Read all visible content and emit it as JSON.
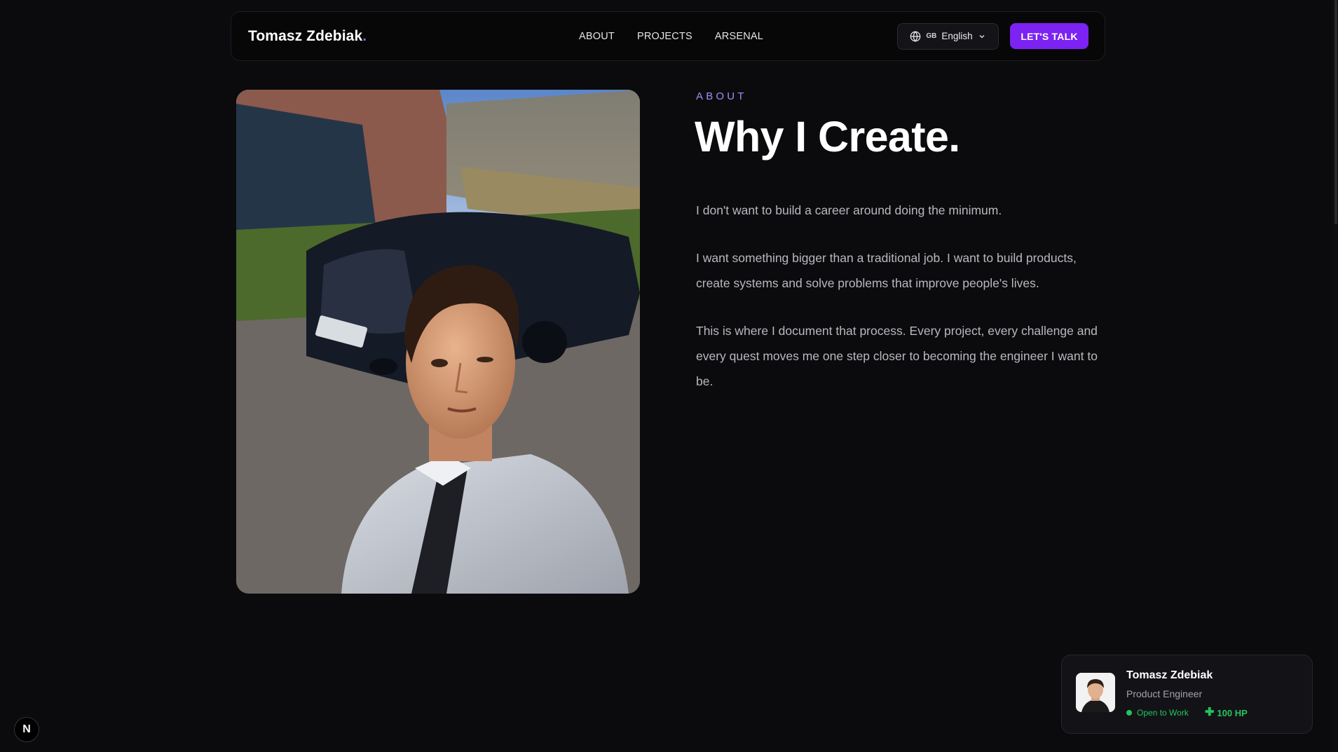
{
  "navbar": {
    "brand": "Tomasz Zdebiak",
    "brand_dot": ".",
    "links": [
      "ABOUT",
      "PROJECTS",
      "ARSENAL"
    ],
    "language_flag": "GB",
    "language_label": "English",
    "cta_label": "LET'S TALK"
  },
  "about": {
    "eyebrow": "ABOUT",
    "headline": "Why I Create.",
    "paragraphs": [
      "I don't want to build a career around doing the minimum.",
      "I want something bigger than a traditional job. I want to build products, create systems and solve problems that improve people's lives.",
      "This is where I document that process. Every project, every challenge and every quest moves me one step closer to becoming the engineer I want to be."
    ]
  },
  "badge": {
    "letter": "N"
  },
  "profile_card": {
    "name": "Tomasz Zdebiak",
    "role": "Product Engineer",
    "status": "Open to Work",
    "hp": "100 HP"
  },
  "colors": {
    "accent": "#7c22f2",
    "eyebrow": "#a78bfa",
    "status_green": "#22c55e",
    "background": "#0b0b0d"
  }
}
